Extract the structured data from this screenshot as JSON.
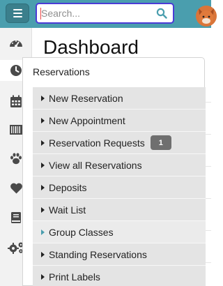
{
  "topbar": {
    "search": {
      "placeholder": "Search...",
      "value": ""
    },
    "menu_icon": "hamburger-icon",
    "search_icon": "magnifier-icon",
    "avatar_icon": "fox-avatar"
  },
  "sidebar": {
    "icons": [
      "dashboard-icon",
      "clock-icon",
      "calendar-icon",
      "barcode-icon",
      "paw-icon",
      "heart-icon",
      "book-icon",
      "gears-icon"
    ],
    "active": "clock-icon"
  },
  "main": {
    "title": "Dashboard"
  },
  "flyout": {
    "title": "Reservations",
    "items": [
      {
        "label": "New Reservation"
      },
      {
        "label": "New Appointment"
      },
      {
        "label": "Reservation Requests",
        "badge": "1"
      },
      {
        "label": "View all Reservations"
      },
      {
        "label": "Deposits"
      },
      {
        "label": "Wait List"
      },
      {
        "label": "Group Classes"
      },
      {
        "label": "Standing Reservations"
      },
      {
        "label": "Print Labels"
      }
    ]
  },
  "colors": {
    "topbar": "#4a9eae",
    "search_border": "#4b3bd6",
    "menu_item_bg": "#e4e4e4",
    "badge_bg": "#6f6f6f",
    "icon_gray": "#4a4a4a"
  }
}
